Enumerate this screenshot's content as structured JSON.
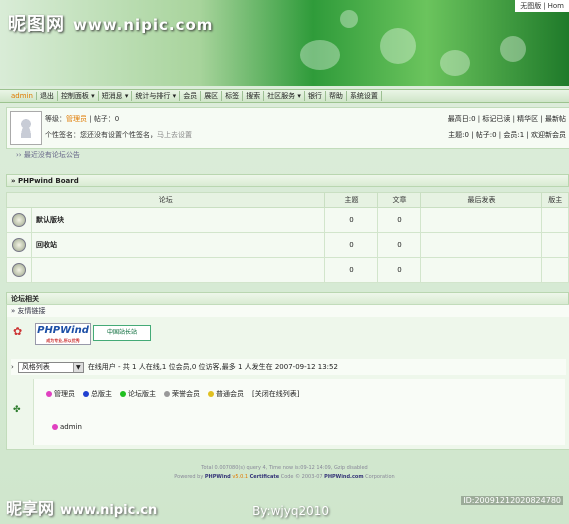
{
  "watermark_top": {
    "brand": "昵图网",
    "url": "www.nipic.com"
  },
  "top_links": [
    "无图版",
    "Hom"
  ],
  "nav": {
    "user": "admin",
    "items": [
      "退出",
      "控制面板 ▾",
      "短消息 ▾",
      "统计与排行 ▾",
      "会员",
      "展区",
      "标签",
      "搜索",
      "社区服务 ▾",
      "银行",
      "帮助",
      "系统设置"
    ]
  },
  "userbox": {
    "level_label": "等级：",
    "level_value": "管理员",
    "posts_label": "帖子：0",
    "signature_label": "个性签名：您还没有设置个性签名，",
    "signature_link": "马上去设置",
    "right_line1": "最高日:0 | 标记已读 | 精华区 | 最新帖",
    "right_line2": "主题:0 | 帖子:0 | 会员:1 | 欢迎新会员"
  },
  "notice": "最近没有论坛公告",
  "board": {
    "title": "» PHPwind Board",
    "headers": [
      "论坛",
      "主题",
      "文章",
      "最后发表",
      "版主"
    ],
    "rows": [
      {
        "name": "默认版块",
        "topics": "0",
        "posts": "0"
      },
      {
        "name": "回收站",
        "topics": "0",
        "posts": "0"
      },
      {
        "name": "",
        "topics": "0",
        "posts": "0"
      }
    ]
  },
  "related": {
    "title": "论坛相关",
    "links_title": "» 友情链接",
    "logo1": "PHPWind",
    "logo1_sub": "成为专业,所以优秀",
    "logo2": "中国站长站",
    "select_value": "风格列表",
    "online_text": "在线用户 - 共 1 人在线,1 位会员,0 位访客,最多 1 人发生在 2007-09-12 13:52",
    "legend": [
      "管理员",
      "总版主",
      "论坛版主",
      "荣誉会员",
      "普通会员"
    ],
    "legend_colors": [
      "#e040c0",
      "#2040d0",
      "#20c020",
      "#999999",
      "#e0c020"
    ],
    "close_online": "[关闭在线列表]",
    "online_user": "admin"
  },
  "footer": {
    "line1": "Total 0.007080(s) query 4, Time now is:09-12 14:09, Gzip disabled",
    "powered": "Powered by",
    "brand": "PHPWind",
    "version": "v5.0.1",
    "cert": "Certificate",
    "code": "Code © 2003-07",
    "site": "PHPWind.com",
    "corp": "Corporation"
  },
  "watermark_bottom": {
    "brand": "昵享网",
    "url": "www.nipic.cn",
    "by": "By:wjyq2010",
    "id": "ID:20091212020824780"
  }
}
